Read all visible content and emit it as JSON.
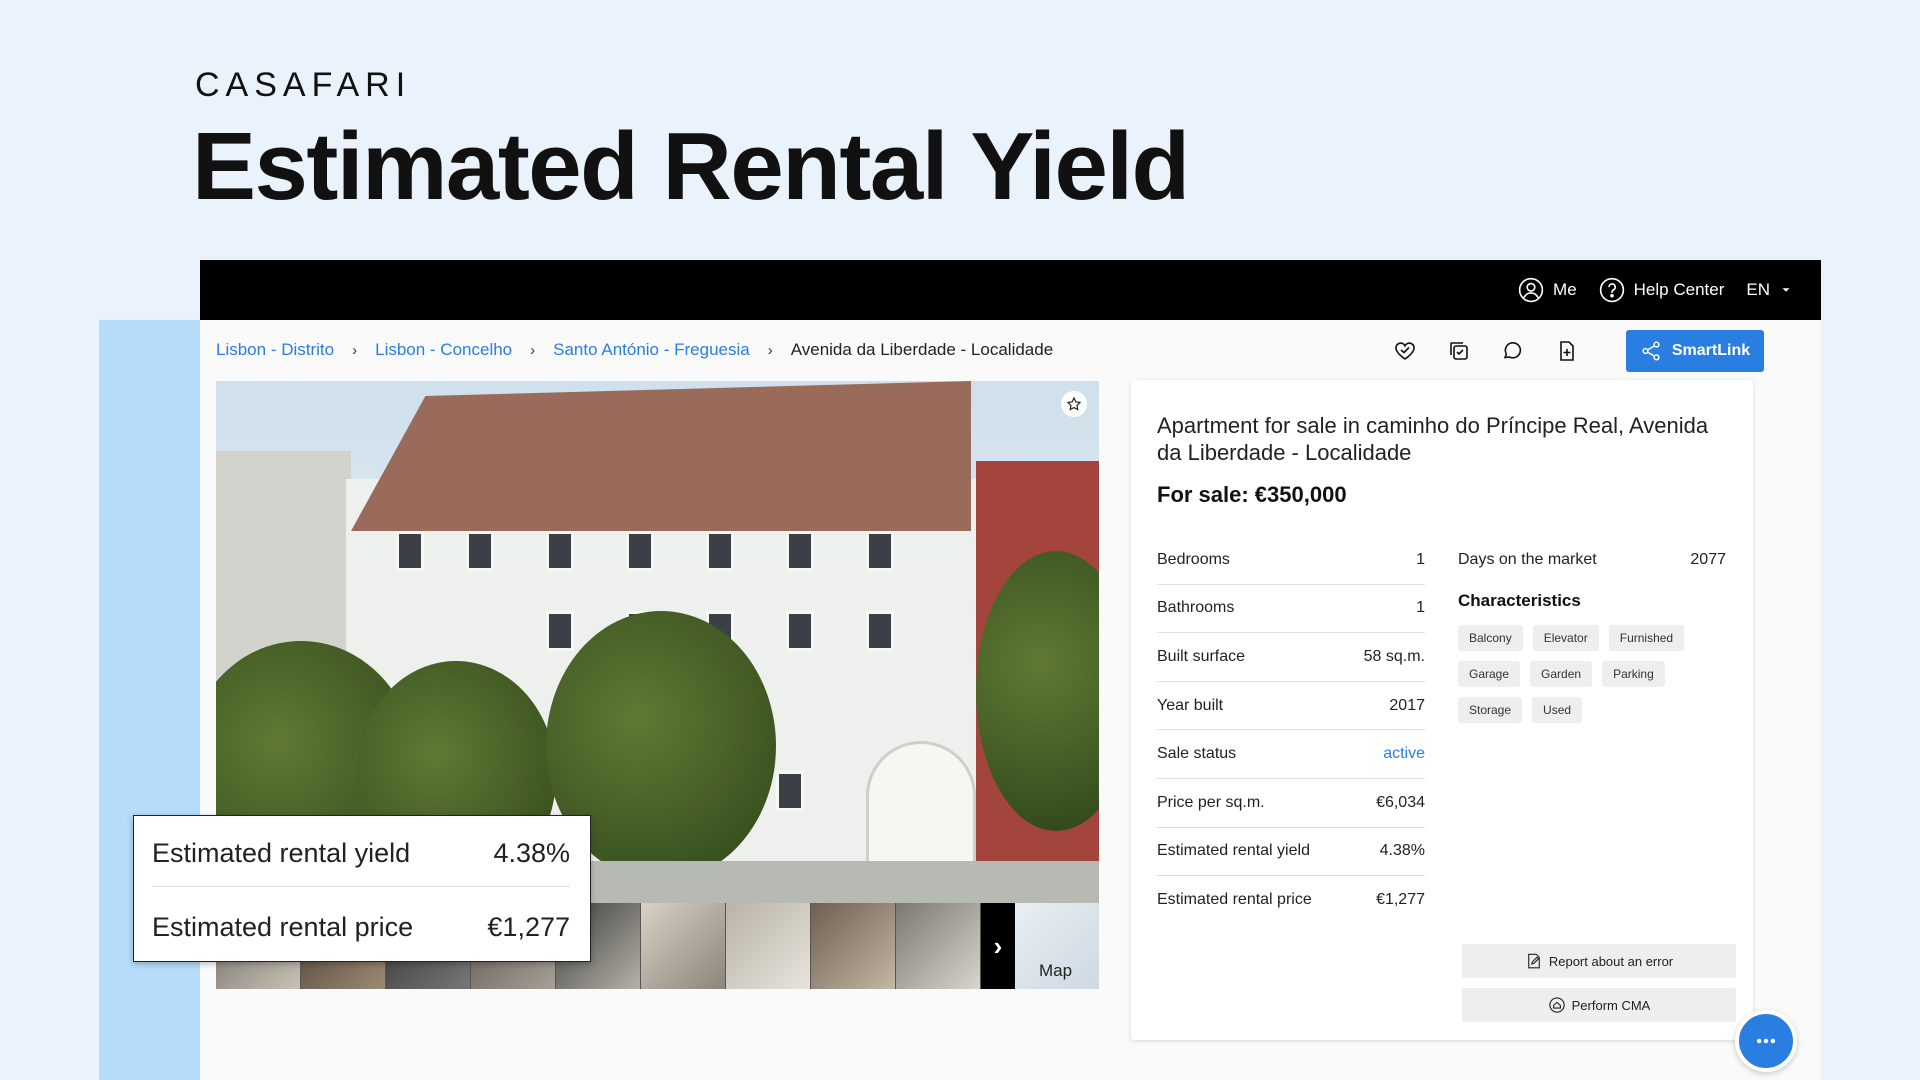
{
  "brand": {
    "logo_text": "CASAFARI"
  },
  "hero": {
    "title": "Estimated Rental Yield"
  },
  "topbar": {
    "me": "Me",
    "help": "Help Center",
    "lang": "EN"
  },
  "breadcrumbs": [
    "Lisbon - Distrito",
    "Lisbon - Concelho",
    "Santo António - Freguesia",
    "Avenida da Liberdade - Localidade"
  ],
  "toolbar": {
    "smartlink": "SmartLink"
  },
  "gallery": {
    "map_label": "Map"
  },
  "listing": {
    "title": "Apartment for sale in caminho do Príncipe Real, Avenida da Liberdade - Localidade",
    "price": "For sale: €350,000",
    "facts": [
      {
        "label": "Bedrooms",
        "value": "1"
      },
      {
        "label": "Bathrooms",
        "value": "1"
      },
      {
        "label": "Built surface",
        "value": "58 sq.m."
      },
      {
        "label": "Year built",
        "value": "2017"
      },
      {
        "label": "Sale status",
        "value": "active"
      },
      {
        "label": "Price per sq.m.",
        "value": "€6,034"
      },
      {
        "label": "Estimated rental yield",
        "value": "4.38%"
      },
      {
        "label": "Estimated rental price",
        "value": "€1,277"
      }
    ],
    "days_on_market": {
      "label": "Days on the market",
      "value": "2077"
    },
    "characteristics_title": "Characteristics",
    "characteristics": [
      "Balcony",
      "Elevator",
      "Furnished",
      "Garage",
      "Garden",
      "Parking",
      "Storage",
      "Used"
    ],
    "actions": {
      "report": "Report about an error",
      "cma": "Perform CMA"
    }
  },
  "callout": {
    "yield_label": "Estimated rental yield",
    "yield_value": "4.38%",
    "price_label": "Estimated rental price",
    "price_value": "€1,277"
  },
  "colors": {
    "accent": "#2a7de1",
    "topbar": "#000000",
    "band": "#b5dcfb",
    "background": "#eaf2fb"
  }
}
